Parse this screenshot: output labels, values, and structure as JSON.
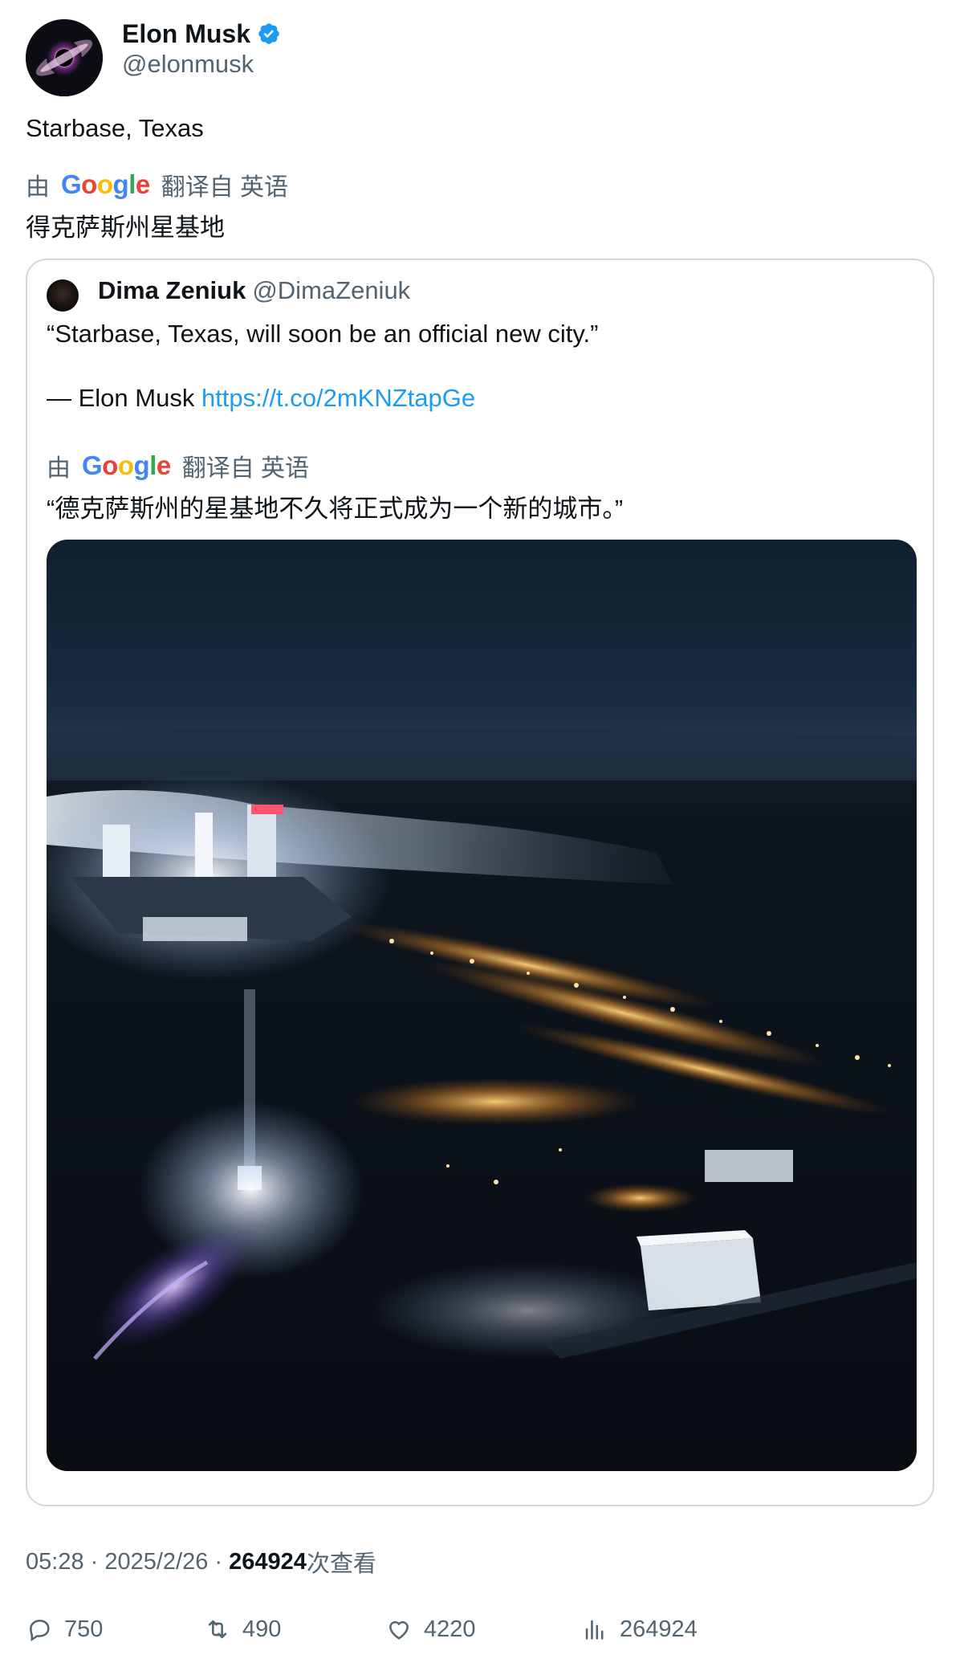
{
  "author": {
    "display_name": "Elon Musk",
    "handle": "@elonmusk",
    "verified": true,
    "avatar_icon": "black-hole-avatar"
  },
  "tweet": {
    "text": "Starbase, Texas",
    "translation": {
      "prefix": "由",
      "provider": "Google",
      "suffix": "翻译自 英语",
      "text": "得克萨斯州星基地"
    }
  },
  "quoted": {
    "display_name": "Dima Zeniuk",
    "handle": "@DimaZeniuk",
    "line1": "“Starbase, Texas, will soon be an official new city.”",
    "line2_prefix": "— Elon Musk ",
    "line2_link": "https://t.co/2mKNZtapGe",
    "translation": {
      "prefix": "由",
      "provider": "Google",
      "suffix": "翻译自 英语",
      "text": "“德克萨斯州的星基地不久将正式成为一个新的城市。”"
    }
  },
  "meta": {
    "time": "05:28",
    "sep1": " · ",
    "date": "2025/2/26",
    "sep2": " · ",
    "views": "264924",
    "views_suffix": "次查看"
  },
  "actions": {
    "replies": "750",
    "retweets": "490",
    "likes": "4220",
    "views": "264924"
  },
  "colors": {
    "verified_badge": "#1d9bf0",
    "link": "#1d9bf0",
    "secondary_text": "#536471"
  }
}
